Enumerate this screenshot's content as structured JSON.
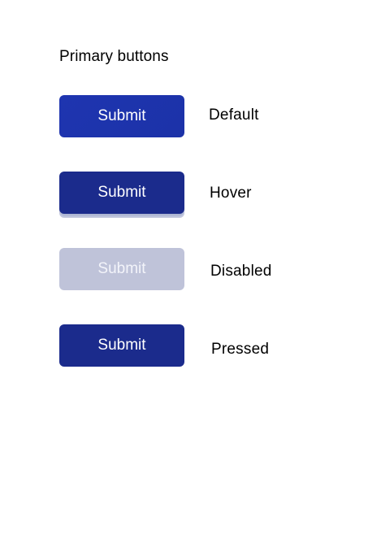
{
  "heading": "Primary buttons",
  "colors": {
    "primary": "#1e35b0",
    "primary_dark": "#1b2b8c",
    "disabled": "#bfc3d9",
    "background": "#ffffff"
  },
  "states": [
    {
      "button_label": "Submit",
      "state_label": "Default"
    },
    {
      "button_label": "Submit",
      "state_label": "Hover"
    },
    {
      "button_label": "Submit",
      "state_label": "Disabled"
    },
    {
      "button_label": "Submit",
      "state_label": "Pressed"
    }
  ]
}
